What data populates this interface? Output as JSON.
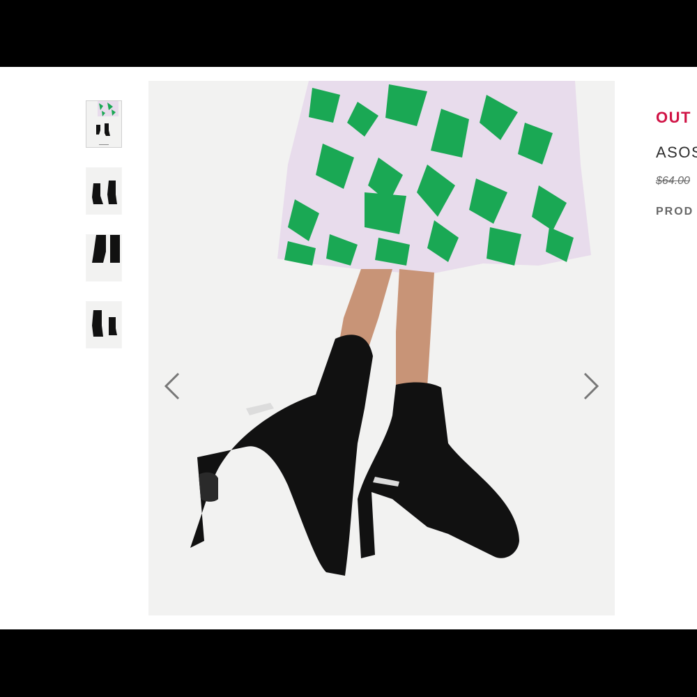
{
  "gallery": {
    "thumbnails": [
      {
        "label": "thumbnail 1",
        "active": true
      },
      {
        "label": "thumbnail 2",
        "active": false
      },
      {
        "label": "thumbnail 3",
        "active": false
      },
      {
        "label": "thumbnail 4",
        "active": false
      }
    ],
    "prev_icon": "chevron-left-icon",
    "next_icon": "chevron-right-icon"
  },
  "product": {
    "status": "OUT",
    "name": "ASOS sock",
    "price": "$64.00",
    "code_label": "PROD"
  },
  "colors": {
    "status": "#d01345",
    "skirt_green": "#1aa854",
    "skirt_lilac": "#e8dcec",
    "boot": "#0d0d0d"
  }
}
